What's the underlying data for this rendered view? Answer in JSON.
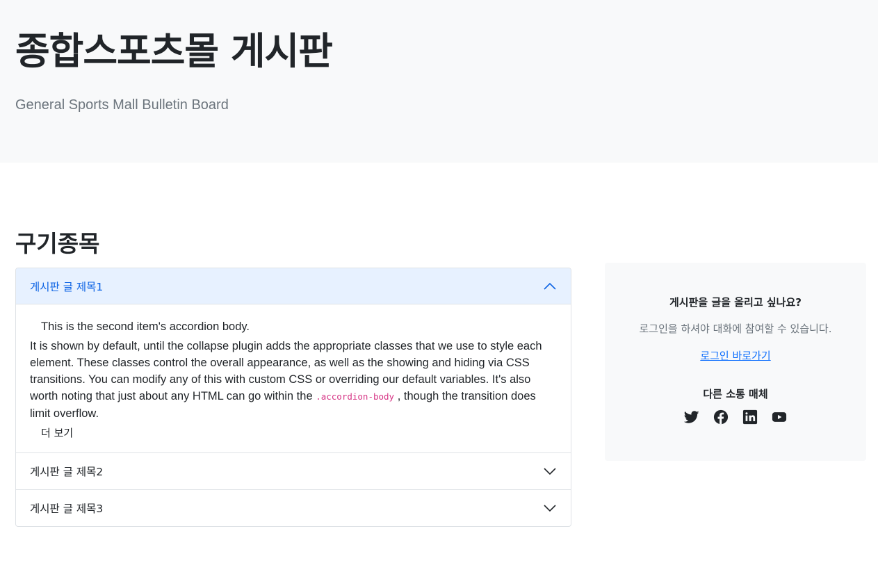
{
  "hero": {
    "title": "종합스포츠몰 게시판",
    "subtitle": "General Sports Mall Bulletin Board"
  },
  "section": {
    "title": "구기종목"
  },
  "accordion": {
    "items": [
      {
        "title": "게시판 글 제목1",
        "expanded": true
      },
      {
        "title": "게시판 글 제목2",
        "expanded": false
      },
      {
        "title": "게시판 글 제목3",
        "expanded": false
      }
    ],
    "body": {
      "lead": "This is the second item's accordion body.",
      "text_before_code": "It is shown by default, until the collapse plugin adds the appropriate classes that we use to style each element. These classes control the overall appearance, as well as the showing and hiding via CSS transitions. You can modify any of this with custom CSS or overriding our default variables. It's also worth noting that just about any HTML can go within the ",
      "code": ".accordion-body",
      "text_after_code": ", though the transition does limit overflow.",
      "more": "더 보기"
    }
  },
  "sidebar": {
    "question": "게시판을 글을 올리고 싶나요?",
    "description": "로그인을 하셔야 대화에 참여할 수 있습니다.",
    "login_link": "로그인 바로가기",
    "other_media": "다른 소통 매체",
    "social_icons": [
      "twitter-icon",
      "facebook-icon",
      "linkedin-icon",
      "youtube-icon"
    ]
  },
  "colors": {
    "hero_bg": "#f8f9fa",
    "accent": "#0c63e4",
    "open_header_bg": "#e7f1ff",
    "link": "#0d6efd",
    "muted": "#6c757d",
    "code": "#d63384"
  }
}
